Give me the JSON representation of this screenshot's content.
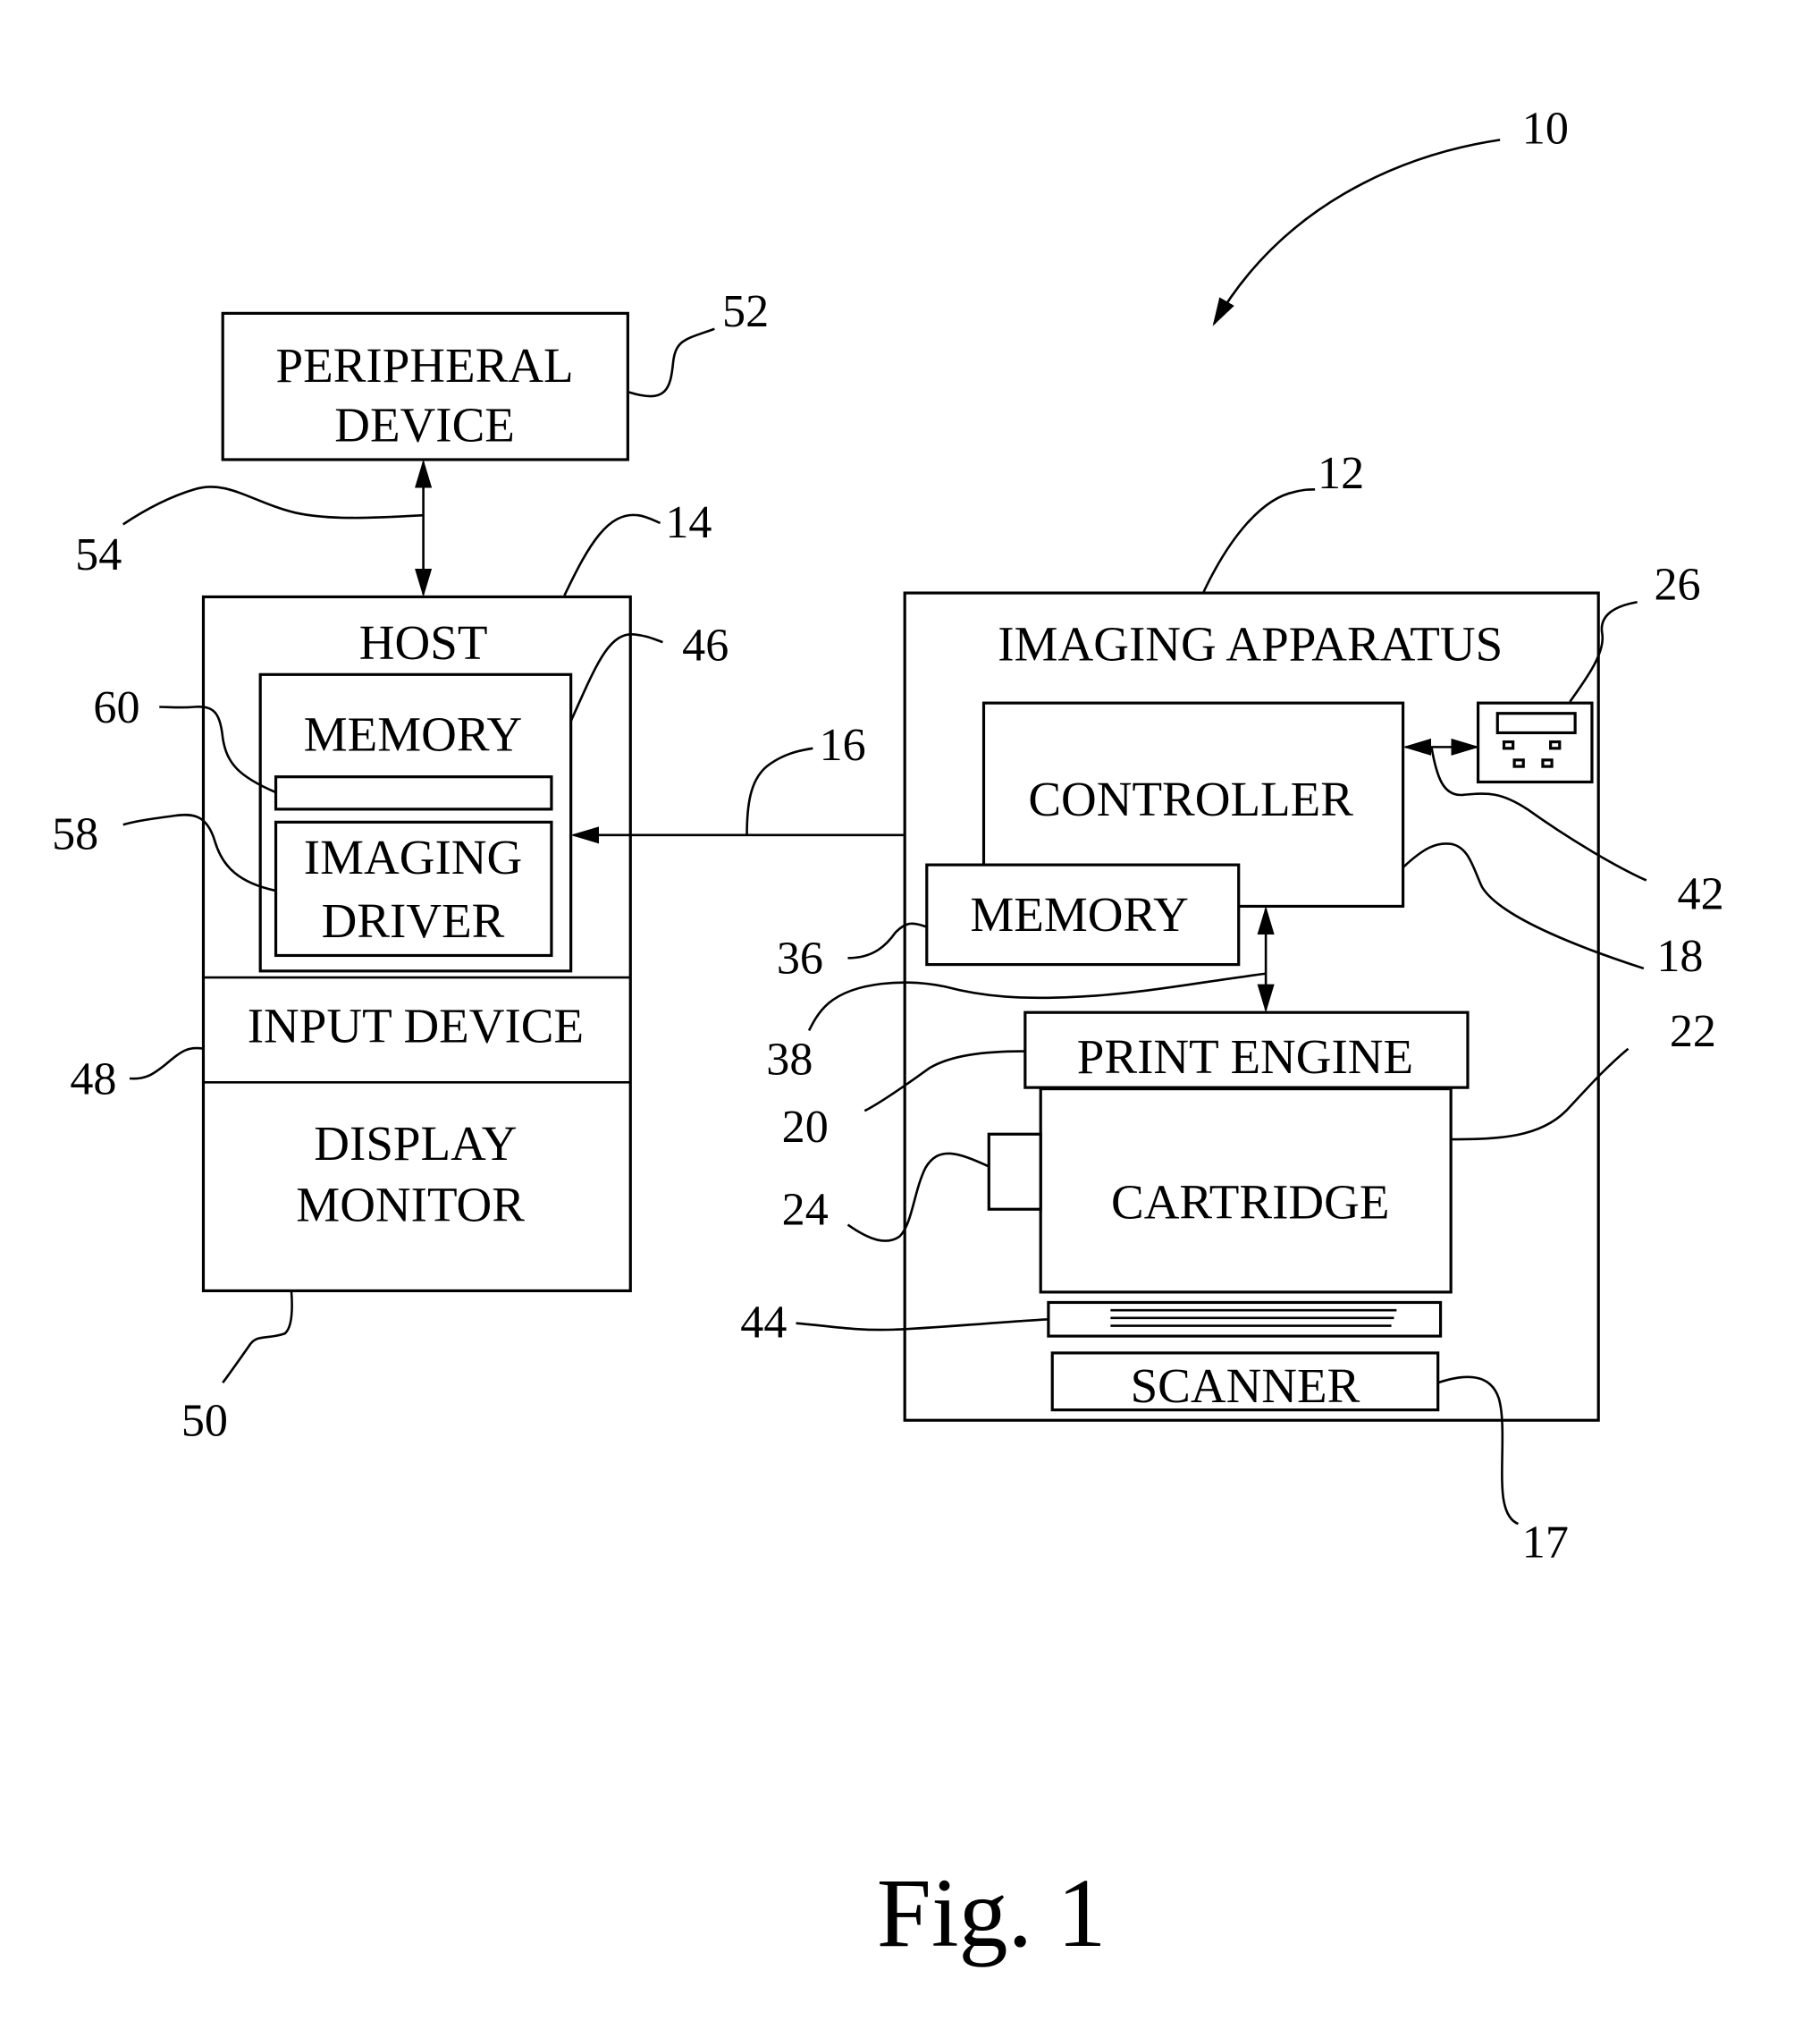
{
  "figure": {
    "caption": "Fig. 1",
    "system_ref": "10"
  },
  "peripheral": {
    "line1": "PERIPHERAL",
    "line2": "DEVICE",
    "ref": "52",
    "link_ref": "54"
  },
  "host": {
    "title": "HOST",
    "ref": "14",
    "memory": {
      "label": "MEMORY",
      "ref": "46",
      "slot_ref": "60"
    },
    "imaging_driver": {
      "line1": "IMAGING",
      "line2": "DRIVER",
      "ref": "58"
    },
    "input_device": {
      "label": "INPUT DEVICE",
      "ref": "48"
    },
    "display_monitor": {
      "line1": "DISPLAY",
      "line2": "MONITOR",
      "ref": "50"
    }
  },
  "link_host_apparatus": {
    "ref": "16"
  },
  "imaging_apparatus": {
    "title": "IMAGING APPARATUS",
    "ref": "12",
    "controller": {
      "label": "CONTROLLER",
      "ref": "18"
    },
    "memory": {
      "label": "MEMORY",
      "ref": "36"
    },
    "memory_bus": {
      "ref": "38"
    },
    "user_interface": {
      "ref": "26",
      "link_ref": "42"
    },
    "print_engine": {
      "label": "PRINT ENGINE",
      "ref": "20"
    },
    "cartridge": {
      "label": "CARTRIDGE",
      "ref": "22",
      "chip_ref": "24"
    },
    "media": {
      "ref": "44"
    },
    "scanner": {
      "label": "SCANNER",
      "ref": "17"
    }
  }
}
